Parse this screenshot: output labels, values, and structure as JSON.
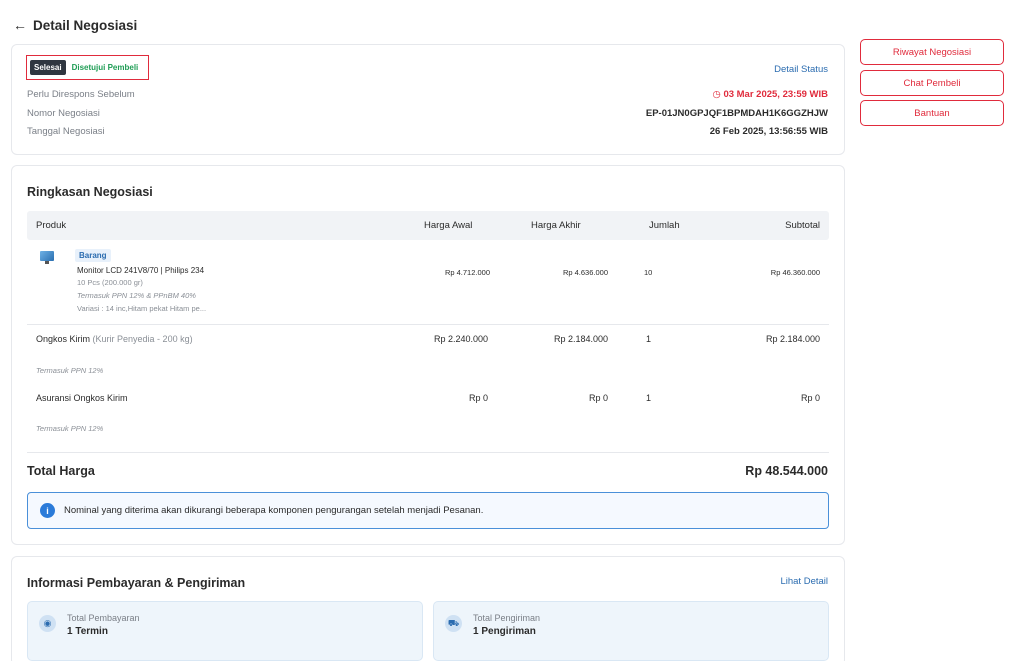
{
  "header": {
    "back_icon": "arrow-left-icon",
    "title": "Detail Negosiasi"
  },
  "status": {
    "badge_done": "Selesai",
    "badge_approved": "Disetujui Pembeli",
    "detail_status_link": "Detail Status",
    "rows": [
      {
        "label": "Perlu Direspons Sebelum",
        "value": "03 Mar 2025, 23:59 WIB"
      },
      {
        "label": "Nomor Negosiasi",
        "value": "EP-01JN0GPJQF1BPMDAH1K6GGZHJW"
      },
      {
        "label": "Tanggal Negosiasi",
        "value": "26 Feb 2025, 13:56:55 WIB"
      }
    ],
    "deadline_icon": "clock-icon"
  },
  "side_buttons": {
    "history": "Riwayat Negosiasi",
    "chat": "Chat Pembeli",
    "help": "Bantuan"
  },
  "summary": {
    "title": "Ringkasan Negosiasi",
    "columns": [
      "Produk",
      "Harga Awal",
      "Harga Akhir",
      "Jumlah",
      "Subtotal"
    ],
    "product": {
      "tag": "Barang",
      "name": "Monitor LCD 241V8/70 | Philips 234",
      "qty_weight": "10 Pcs (200.000 gr)",
      "tax_note": "Termasuk PPN 12% & PPnBM 40%",
      "variant": "Variasi   : 14 inc,Hitam pekat Hitam pe...",
      "harga_awal": "Rp 4.712.000",
      "harga_akhir": "Rp 4.636.000",
      "jumlah": "10",
      "subtotal": "Rp 46.360.000"
    },
    "shipping": {
      "label": "Ongkos Kirim",
      "label_detail": "(Kurir Penyedia - 200 kg)",
      "tax_note": "Termasuk PPN 12%",
      "harga_awal": "Rp 2.240.000",
      "harga_akhir": "Rp 2.184.000",
      "jumlah": "1",
      "subtotal": "Rp 2.184.000"
    },
    "insurance": {
      "label": "Asuransi Ongkos Kirim",
      "tax_note": "Termasuk PPN 12%",
      "harga_awal": "Rp 0",
      "harga_akhir": "Rp 0",
      "jumlah": "1",
      "subtotal": "Rp 0"
    },
    "total_label": "Total Harga",
    "total_value": "Rp 48.544.000",
    "info_text": "Nominal yang diterima akan dikurangi beberapa komponen pengurangan setelah menjadi Pesanan.",
    "info_icon": "info-icon"
  },
  "payment": {
    "title": "Informasi Pembayaran & Pengiriman",
    "lihat_detail": "Lihat Detail",
    "total_payment_label": "Total Pembayaran",
    "total_payment_value": "1 Termin",
    "total_payment_icon": "money-icon",
    "total_shipping_label": "Total Pengiriman",
    "total_shipping_value": "1 Pengiriman",
    "total_shipping_icon": "truck-icon"
  }
}
